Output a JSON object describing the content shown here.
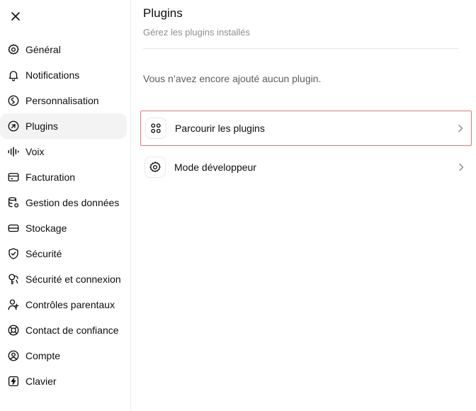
{
  "sidebar": {
    "close_label": "Close",
    "items": [
      {
        "label": "Général",
        "icon": "gear-icon"
      },
      {
        "label": "Notifications",
        "icon": "bell-icon"
      },
      {
        "label": "Personnalisation",
        "icon": "personalize-icon"
      },
      {
        "label": "Plugins",
        "icon": "plugin-icon",
        "active": true
      },
      {
        "label": "Voix",
        "icon": "voice-wave-icon"
      },
      {
        "label": "Facturation",
        "icon": "card-icon"
      },
      {
        "label": "Gestion des données",
        "icon": "database-gear-icon"
      },
      {
        "label": "Stockage",
        "icon": "storage-icon"
      },
      {
        "label": "Sécurité",
        "icon": "shield-icon"
      },
      {
        "label": "Sécurité et connexion",
        "icon": "key-icon"
      },
      {
        "label": "Contrôles parentaux",
        "icon": "parent-user-icon"
      },
      {
        "label": "Contact de confiance",
        "icon": "lifebuoy-icon"
      },
      {
        "label": "Compte",
        "icon": "user-circle-icon"
      },
      {
        "label": "Clavier",
        "icon": "keyboard-bolt-icon"
      }
    ]
  },
  "main": {
    "title": "Plugins",
    "subtitle": "Gérez les plugins installés",
    "empty_text": "Vous n’avez encore ajouté aucun plugin.",
    "rows": [
      {
        "label": "Parcourir les plugins",
        "icon": "grid-icon"
      },
      {
        "label": "Mode développeur",
        "icon": "gear-icon"
      }
    ]
  },
  "colors": {
    "highlight_border": "#e07a7a",
    "active_bg": "#f3f3f3",
    "muted_text": "#8f8f8f"
  }
}
